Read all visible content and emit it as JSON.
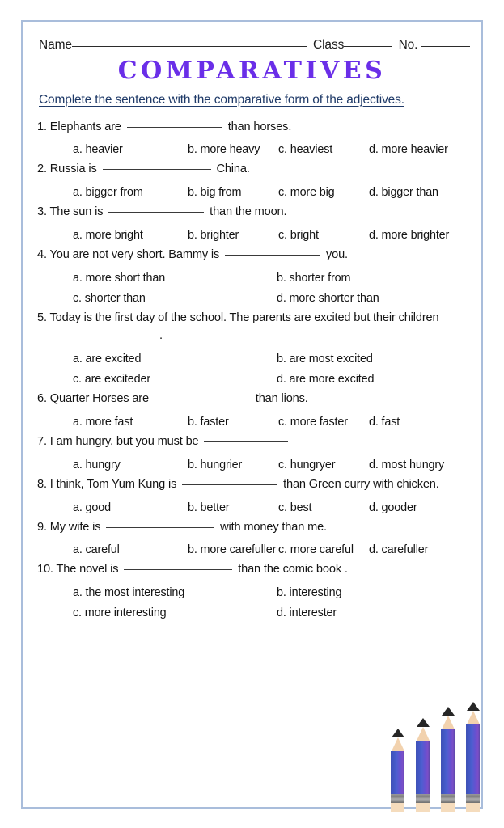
{
  "header": {
    "name_label": "Name",
    "class_label": "Class",
    "no_label": "No."
  },
  "title": "COMPARATIVES",
  "title_color": "#6a2ee8",
  "instruction": "Complete the sentence with the comparative form of the adjectives.",
  "instruction_color": "#1f3a68",
  "border_color": "#a9bddb",
  "questions": [
    {
      "number": "1.",
      "stem_before": "Elephants are",
      "stem_after": "than horses.",
      "options": [
        "a. heavier",
        "b. more heavy",
        "c. heaviest",
        "d. more heavier"
      ]
    },
    {
      "number": "2.",
      "stem_before": "Russia is",
      "stem_after": "China.",
      "options": [
        "a. bigger from",
        "b. big from",
        "c. more big",
        "d. bigger than"
      ]
    },
    {
      "number": "3.",
      "stem_before": "The sun is",
      "stem_after": "than the moon.",
      "options": [
        "a. more bright",
        "b. brighter",
        "c. bright",
        "d. more brighter"
      ]
    },
    {
      "number": "4.",
      "stem_before": "You are not very short. Bammy is",
      "stem_after": "you.",
      "options": [
        "a. more short than",
        "b. shorter from",
        "c. shorter than",
        "d. more shorter than"
      ]
    },
    {
      "number": "5.",
      "stem_before": "Today is the first day of the school. The parents are excited but their children",
      "stem_after": ".",
      "options": [
        "a. are excited",
        "b. are most excited",
        "c. are exciteder",
        "d. are more excited"
      ]
    },
    {
      "number": "6.",
      "stem_before": "Quarter Horses are",
      "stem_after": "than lions.",
      "options": [
        "a. more fast",
        "b. faster",
        "c. more faster",
        "d. fast"
      ]
    },
    {
      "number": "7.",
      "stem_before": "I am hungry, but you must be",
      "stem_after": "",
      "options": [
        "a. hungry",
        "b. hungrier",
        "c. hungryer",
        "d. most hungry"
      ]
    },
    {
      "number": "8.",
      "stem_before": "I think, Tom Yum Kung is",
      "stem_after": "than Green curry with chicken.",
      "options": [
        "a. good",
        "b. better",
        "c. best",
        "d. gooder"
      ]
    },
    {
      "number": "9.",
      "stem_before": "My wife is",
      "stem_after": "with money than me.",
      "options": [
        "a. careful",
        "b. more carefuller",
        "c. more careful",
        "d. carefuller"
      ]
    },
    {
      "number": "10.",
      "stem_before": "The novel is",
      "stem_after": "than the comic book .",
      "options": [
        "a. the most interesting",
        "b. interesting",
        "c. more interesting",
        "d. interester"
      ]
    }
  ],
  "illustration": {
    "name": "four-pencils",
    "count": 4,
    "barrel_color": "#4c5fd0",
    "accent_color": "#6b4fd0",
    "wood_color": "#f2d2ae",
    "graphite_color": "#262626",
    "ferrule_color": "#8c8c8c",
    "eraser_color": "#f5dcbd"
  }
}
